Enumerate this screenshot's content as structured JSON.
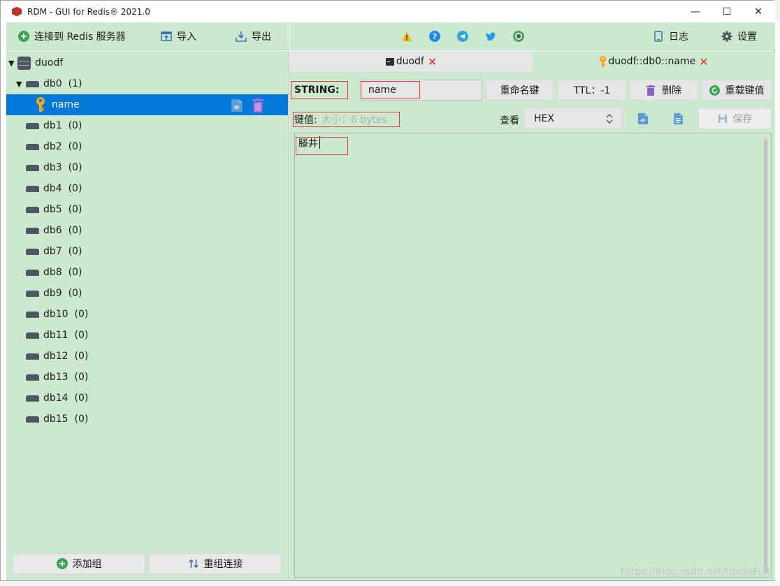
{
  "window": {
    "title": "RDM - GUI for Redis® 2021.0",
    "minimize": "—",
    "maximize": "☐",
    "close": "✕"
  },
  "toolbar": {
    "connect_label": "连接到 Redis 服务器",
    "import_label": "导入",
    "export_label": "导出",
    "log_label": "日志",
    "settings_label": "设置"
  },
  "tree": {
    "server_name": "duodf",
    "databases": [
      {
        "name": "db0",
        "count": "(1)"
      },
      {
        "name": "db1",
        "count": "(0)"
      },
      {
        "name": "db2",
        "count": "(0)"
      },
      {
        "name": "db3",
        "count": "(0)"
      },
      {
        "name": "db4",
        "count": "(0)"
      },
      {
        "name": "db5",
        "count": "(0)"
      },
      {
        "name": "db6",
        "count": "(0)"
      },
      {
        "name": "db7",
        "count": "(0)"
      },
      {
        "name": "db8",
        "count": "(0)"
      },
      {
        "name": "db9",
        "count": "(0)"
      },
      {
        "name": "db10",
        "count": "(0)"
      },
      {
        "name": "db11",
        "count": "(0)"
      },
      {
        "name": "db12",
        "count": "(0)"
      },
      {
        "name": "db13",
        "count": "(0)"
      },
      {
        "name": "db14",
        "count": "(0)"
      },
      {
        "name": "db15",
        "count": "(0)"
      }
    ],
    "selected_key": "name"
  },
  "left_footer": {
    "add_group_label": "添加组",
    "regroup_label": "重组连接"
  },
  "tabs": [
    {
      "label": "duodf",
      "close": "✕"
    },
    {
      "label": "duodf::db0::name",
      "close": "✕"
    }
  ],
  "key_editor": {
    "type_label": "STRING:",
    "key_name": "name",
    "rename_label": "重命名键",
    "ttl_label": "TTL：-1",
    "delete_label": "删除",
    "reload_label": "重载键值",
    "value_label": "键值:",
    "size_label": "大小：6 bytes",
    "view_label": "查看",
    "view_format": "HEX",
    "save_label": "保存",
    "value_text": "滕井"
  },
  "watermark": "https://blog.csdn.net/UncleFull",
  "colors": {
    "panel_bg": "#cce8cf",
    "selected_bg": "#0078d7",
    "tab_close": "#e0301e",
    "highlight_box": "#e53935"
  }
}
